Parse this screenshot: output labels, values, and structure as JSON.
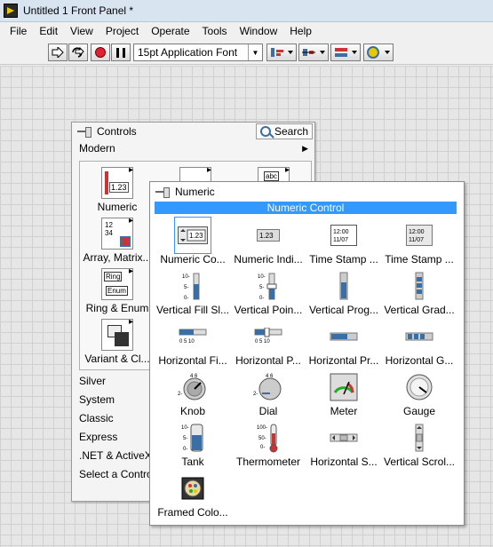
{
  "window": {
    "title": "Untitled 1 Front Panel *"
  },
  "menu": [
    "File",
    "Edit",
    "View",
    "Project",
    "Operate",
    "Tools",
    "Window",
    "Help"
  ],
  "toolbar": {
    "font": "15pt Application Font"
  },
  "controls_palette": {
    "title": "Controls",
    "search_label": "Search",
    "modern_label": "Modern",
    "tiles": [
      "Numeric",
      "Array, Matrix...",
      "Ring & Enum",
      "Variant & Cl..."
    ],
    "categories": [
      "Silver",
      "System",
      "Classic",
      "Express",
      ".NET & ActiveX",
      "Select a Contro"
    ]
  },
  "numeric_palette": {
    "title": "Numeric",
    "tooltip": "Numeric Control",
    "items": [
      "Numeric Co...",
      "Numeric Indi...",
      "Time Stamp ...",
      "Time Stamp ...",
      "Vertical Fill Sl...",
      "Vertical Poin...",
      "Vertical Prog...",
      "Vertical Grad...",
      "Horizontal Fi...",
      "Horizontal P...",
      "Horizontal Pr...",
      "Horizontal G...",
      "Knob",
      "Dial",
      "Meter",
      "Gauge",
      "Tank",
      "Thermometer",
      "Horizontal S...",
      "Vertical Scrol...",
      "Framed Colo..."
    ]
  },
  "colors": {
    "selection": "#3399ff",
    "panel_grid": "#d0d0d0"
  }
}
